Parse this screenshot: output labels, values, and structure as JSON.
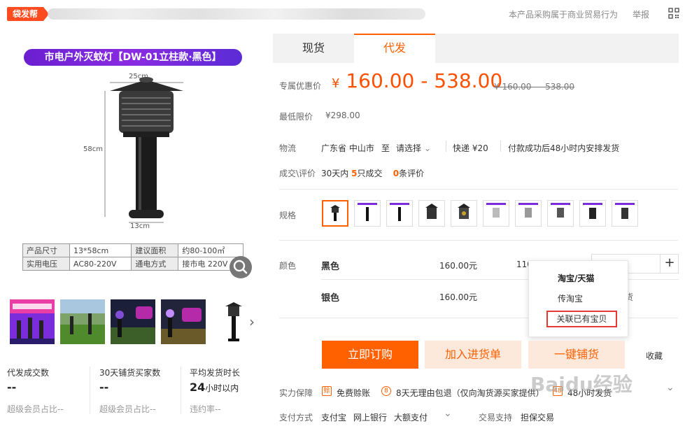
{
  "topbar": {
    "brand": "袋发帮",
    "notice": "本产品采购属于商业贸易行为",
    "report": "举报"
  },
  "product": {
    "banner": "市电户外灭蚊灯【DW-01立柱款·黑色】",
    "dim_width": "25cm",
    "dim_height": "58cm",
    "dim_base": "13cm",
    "spec_table": [
      [
        "产品尺寸",
        "13*58cm",
        "建议面积",
        "约80-100㎡"
      ],
      [
        "实用电压",
        "AC80-220V",
        "通电方式",
        "接市电 220V"
      ]
    ]
  },
  "stats": [
    {
      "label": "代发成交数",
      "value": "--",
      "sub": "超级会员占比--"
    },
    {
      "label": "30天铺货买家数",
      "value": "--",
      "sub": "超级会员占比--"
    },
    {
      "label": "平均发货时长",
      "value": "24",
      "unit": "小时以内",
      "sub": "违约率--"
    }
  ],
  "tabs": [
    "现货",
    "代发"
  ],
  "price": {
    "label": "专属优惠价",
    "currency": "¥",
    "low": "160.00",
    "dash": "-",
    "high": "538.00",
    "original": "¥ 160.00 — 538.00"
  },
  "min_price": {
    "label": "最低限价",
    "value": "¥298.00"
  },
  "logistics": {
    "label": "物流",
    "from": "广东省 中山市",
    "to_word": "至",
    "select": "请选择",
    "express": "快递 ¥20",
    "ship": "付款成功后48小时内安排发货"
  },
  "trade": {
    "label": "成交\\评价",
    "days": "30天内",
    "count": "5",
    "count_unit": "只成交",
    "reviews": "0",
    "reviews_unit": "条评价"
  },
  "spec": {
    "label": "规格"
  },
  "color": {
    "label": "颜色",
    "rows": [
      {
        "name": "黑色",
        "price": "160.00元",
        "stock": "110"
      },
      {
        "name": "银色",
        "price": "160.00元",
        "stock": "货"
      }
    ]
  },
  "popup": {
    "title": "淘宝/天猫",
    "item1": "传淘宝",
    "item2": "关联已有宝贝"
  },
  "buttons": {
    "buy": "立即订购",
    "cart": "加入进货单",
    "onekey": "一键铺货",
    "fav": "收藏"
  },
  "guarantee": {
    "label": "实力保障",
    "items": [
      "免费赊账",
      "8天无理由包退（仅向淘货源买家提供）",
      "48小时发货"
    ],
    "icons": [
      "赊",
      "8",
      "48"
    ]
  },
  "payment": {
    "label": "支付方式",
    "methods": [
      "支付宝",
      "网上银行",
      "大额支付"
    ],
    "support_label": "交易支持",
    "support": "担保交易"
  },
  "watermark": "Baidu经验",
  "colors": {
    "accent": "#ff6000",
    "brand": "#ff4b1f",
    "popup_highlight": "#e53935"
  }
}
